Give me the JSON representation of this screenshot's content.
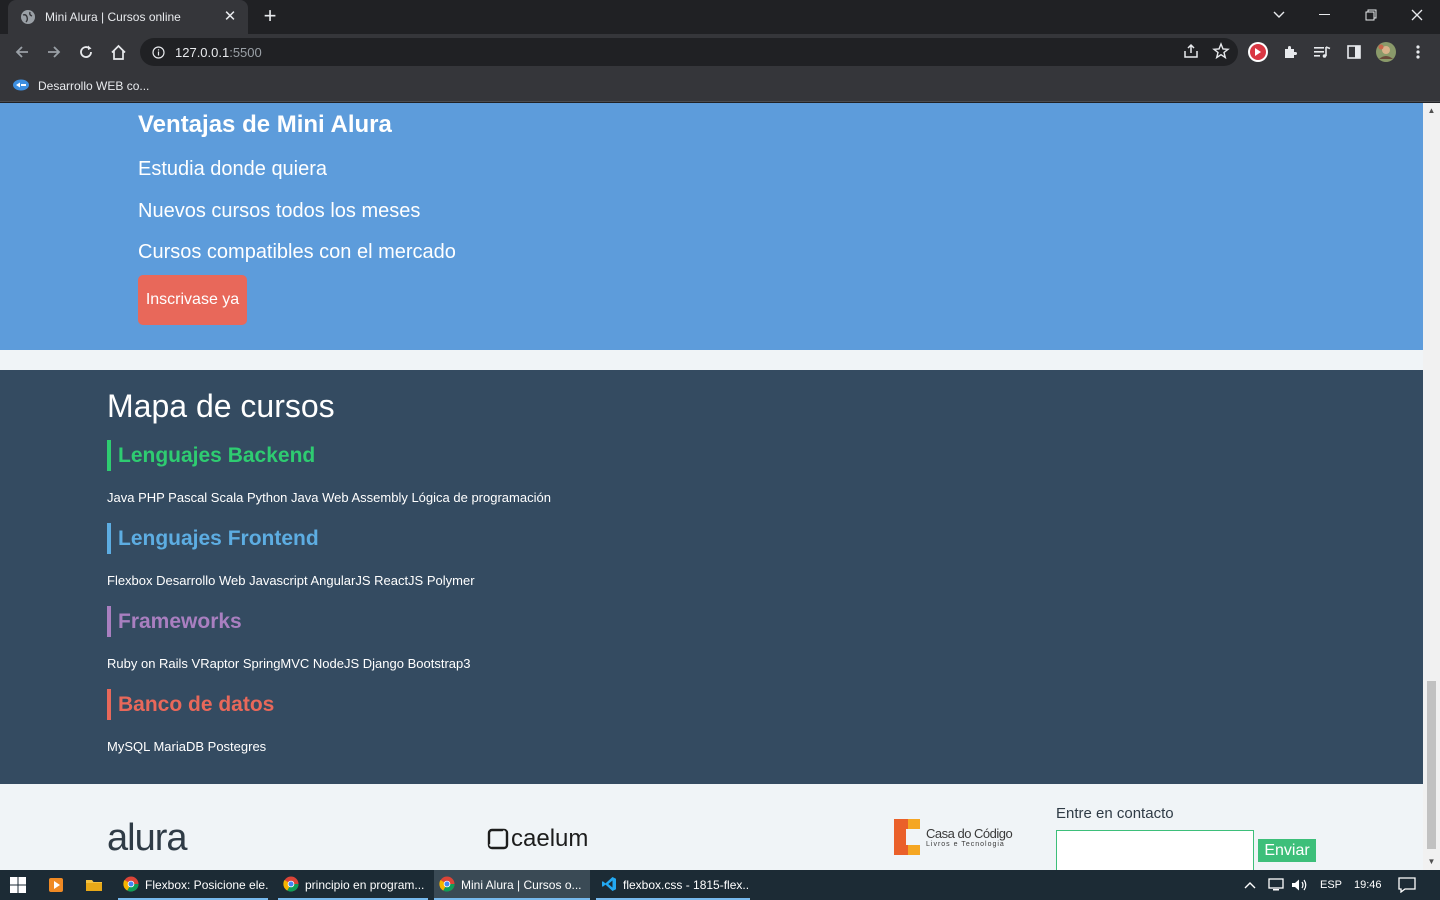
{
  "browser": {
    "tab_title": "Mini Alura | Cursos online",
    "tab_close": "✕",
    "new_tab": "+",
    "url_host": "127.0.0.1",
    "url_port": ":5500",
    "bookmark": "Desarrollo WEB co..."
  },
  "ventajas": {
    "title": "Ventajas de Mini Alura",
    "items": [
      "Estudia donde quiera",
      "Nuevos cursos todos los meses",
      "Cursos compatibles con el mercado"
    ],
    "button": "Inscrivase ya"
  },
  "mapa": {
    "title": "Mapa de cursos",
    "categories": [
      {
        "name": "Lenguajes Backend",
        "color": "#2ecc71",
        "courses": "Java PHP Pascal Scala Python Java Web Assembly Lógica de programación"
      },
      {
        "name": "Lenguajes Frontend",
        "color": "#5dade2",
        "courses": "Flexbox Desarrollo Web Javascript AngularJS ReactJS Polymer"
      },
      {
        "name": "Frameworks",
        "color": "#a97fc0",
        "courses": "Ruby on Rails VRaptor SpringMVC NodeJS Django Bootstrap3"
      },
      {
        "name": "Banco de datos",
        "color": "#e8685a",
        "courses": "MySQL MariaDB Postegres"
      }
    ]
  },
  "footer": {
    "logo_alura": "alura",
    "logo_caelum": "caelum",
    "logo_casa_line1": "Casa do Código",
    "logo_casa_line2": "Livros e Tecnologia",
    "contact_label": "Entre en contacto",
    "send_button": "Enviar"
  },
  "taskbar": {
    "apps": [
      "Flexbox: Posicione ele...",
      "principio en program...",
      "Mini Alura | Cursos o...",
      "flexbox.css - 1815-flex..."
    ],
    "language": "ESP",
    "time": "19:46"
  }
}
